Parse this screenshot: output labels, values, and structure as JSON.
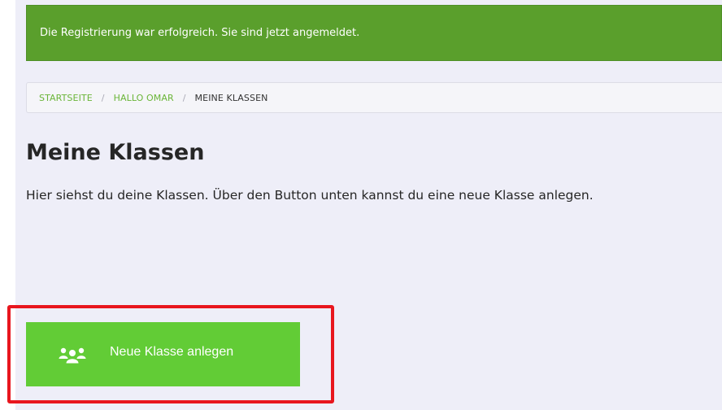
{
  "alert": {
    "message": "Die Registrierung war erfolgreich. Sie sind jetzt angemeldet."
  },
  "breadcrumb": {
    "items": [
      {
        "label": "STARTSEITE"
      },
      {
        "label": "HALLO OMAR"
      },
      {
        "label": "MEINE KLASSEN"
      }
    ],
    "separator": "/"
  },
  "main": {
    "title": "Meine Klassen",
    "description": "Hier siehst du deine Klassen. Über den Button unten kannst du eine neue Klasse anlegen."
  },
  "actions": {
    "new_class_label": "Neue Klasse anlegen",
    "new_class_icon": "users-icon"
  },
  "colors": {
    "alert_bg": "#5a9f2c",
    "accent": "#62cc36",
    "link": "#6ab538",
    "highlight": "#e8161e"
  }
}
